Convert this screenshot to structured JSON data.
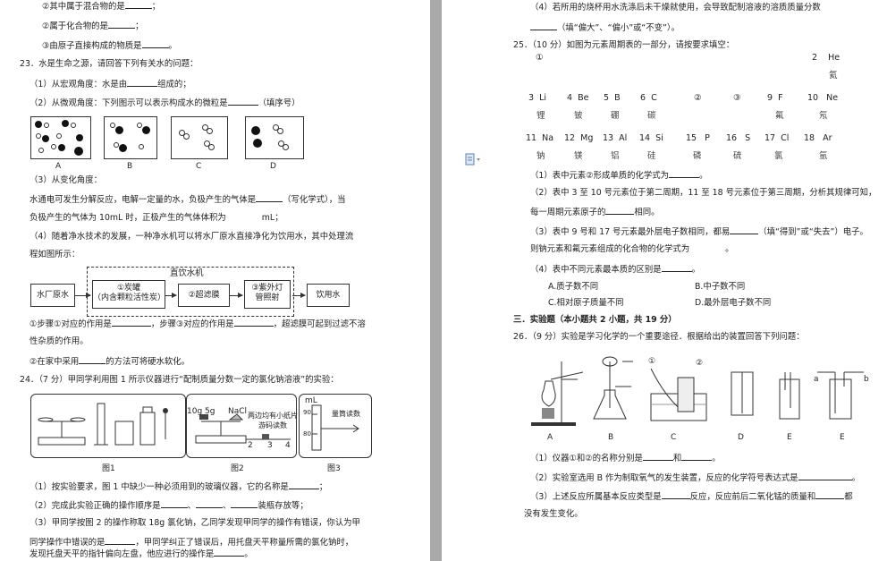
{
  "left": {
    "l1": "②其中属于混合物的是",
    "l1b": "；",
    "l2": "②属于化合物的是",
    "l2b": "；",
    "l3": "③由原子直接构成的物质是",
    "l3b": "。",
    "q23": "23．水是生命之源，请回答下列有关水的问题：",
    "q23_1": "（1）从宏观角度：水是由",
    "q23_1b": "组成的；",
    "q23_2": "（2）从微观角度：下列图示可以表示构成水的微粒是",
    "q23_2b": "（填序号）",
    "fig_labels": [
      "A",
      "B",
      "C",
      "D"
    ],
    "q23_3": "（3）从变化角度：",
    "q23_3a": "水通电可发生分解反应，电解一定量的水，负极产生的气体是",
    "q23_3ab": "（写化学式），当",
    "q23_3c": "负极产生的气体为 10mL 时，正极产生的气体体积为",
    "q23_3cb": "mL；",
    "q23_4": "（4）随着净水技术的发展，一种净水机可以将水厂原水直接净化为饮用水，其中处理流",
    "q23_4b": "程如图所示：",
    "flow_title": "直饮水机",
    "flow_raw": "水厂原水",
    "flow_step1": "①炭罐",
    "flow_step1_sub": "（内含颗粒活性炭）",
    "flow_step2": "②超滤膜",
    "flow_step3": "③紫外灯",
    "flow_step3_sub": "管照射",
    "flow_out": "饮用水",
    "q23_4c": "①步骤①对应的作用是",
    "q23_4c2": "，步骤③对应的作用是",
    "q23_4c3": "，超滤膜可起到过滤不溶",
    "q23_4d": "性杂质的作用。",
    "q23_4e": "②在家中采用",
    "q23_4eb": "的方法可将硬水软化。",
    "q24": "24．（7 分）甲同学利用图 1 所示仪器进行“配制质量分数一定的氯化钠溶液”的实验：",
    "fig2_weights": "10g 5g",
    "fig2_nacl": "NaCl",
    "fig2_note": "两边均有小纸片",
    "fig2_note2": "游码读数",
    "fig2_scale": [
      "2",
      "3",
      "4"
    ],
    "fig3_unit": "mL",
    "fig3_ticks": [
      "90",
      "80"
    ],
    "fig3_label": "量筒读数",
    "fig_captions": [
      "图1",
      "图2",
      "图3"
    ],
    "q24_1": "（1）按实验要求，图 1 中缺少一种必须用到的玻璃仪器，它的名称是",
    "q24_1b": "；",
    "q24_2": "（2）完成此实验正确的操作顺序是",
    "q24_2b": "、",
    "q24_2c": "、",
    "q24_2d": "装瓶存放等；",
    "q24_3": "（3）甲同学按图 2 的操作称取 18g 氯化钠，乙同学发现甲同学的操作有错误，你认为甲",
    "q24_3b": "同学操作中错误的是",
    "q24_3c": "，甲同学纠正了错误后，用托盘天平称量所需的氯化钠时，",
    "q24_3d": "发现托盘天平的指针偏向左盘，他应进行的操作是",
    "q24_3db": "。"
  },
  "right": {
    "q24_4": "（4）若所用的烧杯用水洗涤后未干燥就使用，会导致配制溶液的溶质质量分数",
    "q24_4b": "（填“偏大”、“偏小”或“不变”）。",
    "q25": "25．（10 分）如图为元素周期表的一部分，请按要求填空：",
    "pt_row1": [
      {
        "n": "①",
        "s": "",
        "name": ""
      },
      {
        "n": "2",
        "s": "He",
        "name": "氦"
      }
    ],
    "pt_row2": [
      {
        "n": "3",
        "s": "Li",
        "name": "锂"
      },
      {
        "n": "4",
        "s": "Be",
        "name": "铍"
      },
      {
        "n": "5",
        "s": "B",
        "name": "硼"
      },
      {
        "n": "6",
        "s": "C",
        "name": "碳"
      },
      {
        "n": "②",
        "s": "",
        "name": ""
      },
      {
        "n": "③",
        "s": "",
        "name": ""
      },
      {
        "n": "9",
        "s": "F",
        "name": "氟"
      },
      {
        "n": "10",
        "s": "Ne",
        "name": "氖"
      }
    ],
    "pt_row3": [
      {
        "n": "11",
        "s": "Na",
        "name": "钠"
      },
      {
        "n": "12",
        "s": "Mg",
        "name": "镁"
      },
      {
        "n": "13",
        "s": "Al",
        "name": "铝"
      },
      {
        "n": "14",
        "s": "Si",
        "name": "硅"
      },
      {
        "n": "15",
        "s": "P",
        "name": "磷"
      },
      {
        "n": "16",
        "s": "S",
        "name": "硫"
      },
      {
        "n": "17",
        "s": "Cl",
        "name": "氯"
      },
      {
        "n": "18",
        "s": "Ar",
        "name": "氩"
      }
    ],
    "q25_1": "（1）表中元素②形成单质的化学式为",
    "q25_1b": "。",
    "q25_2": "（2）表中 3 至 10 号元素位于第二周期，11 至 18 号元素位于第三周期，分析其规律可知，",
    "q25_2b": "每一周期元素原子的",
    "q25_2c": "相同。",
    "q25_3": "（3）表中 9 号和 17 号元素最外层电子数相同，都易",
    "q25_3b": "（填“得到”或“失去”）电子。",
    "q25_3c": "则钠元素和氟元素组成的化合物的化学式为",
    "q25_3d": "。",
    "q25_4": "（4）表中不同元素最本质的区别是",
    "q25_4b": "。",
    "options": [
      "A.质子数不同",
      "B.中子数不同",
      "C.相对原子质量不同",
      "D.最外层电子数不同"
    ],
    "sec3": "三．实验题（本小题共 2 小题，共 19 分）",
    "q26": "26．（9 分）实验是学习化学的一个重要途径．根据给出的装置回答下列问题：",
    "app_labels": [
      "A",
      "B",
      "C",
      "D",
      "E",
      "E"
    ],
    "app_marks": [
      "①",
      "②",
      "a",
      "b"
    ],
    "q26_1": "（1）仪器①和②的名称分别是",
    "q26_1b": "和",
    "q26_1c": "。",
    "q26_2": "（2）实验室选用 B 作为制取氧气的发生装置，反应的化学符号表达式是",
    "q26_2b": "。",
    "q26_3": "（3）上述反应所属基本反应类型是",
    "q26_3b": "反应，反应前后二氧化锰的质量和",
    "q26_3c": "都",
    "q26_3d": "没有发生变化。"
  }
}
